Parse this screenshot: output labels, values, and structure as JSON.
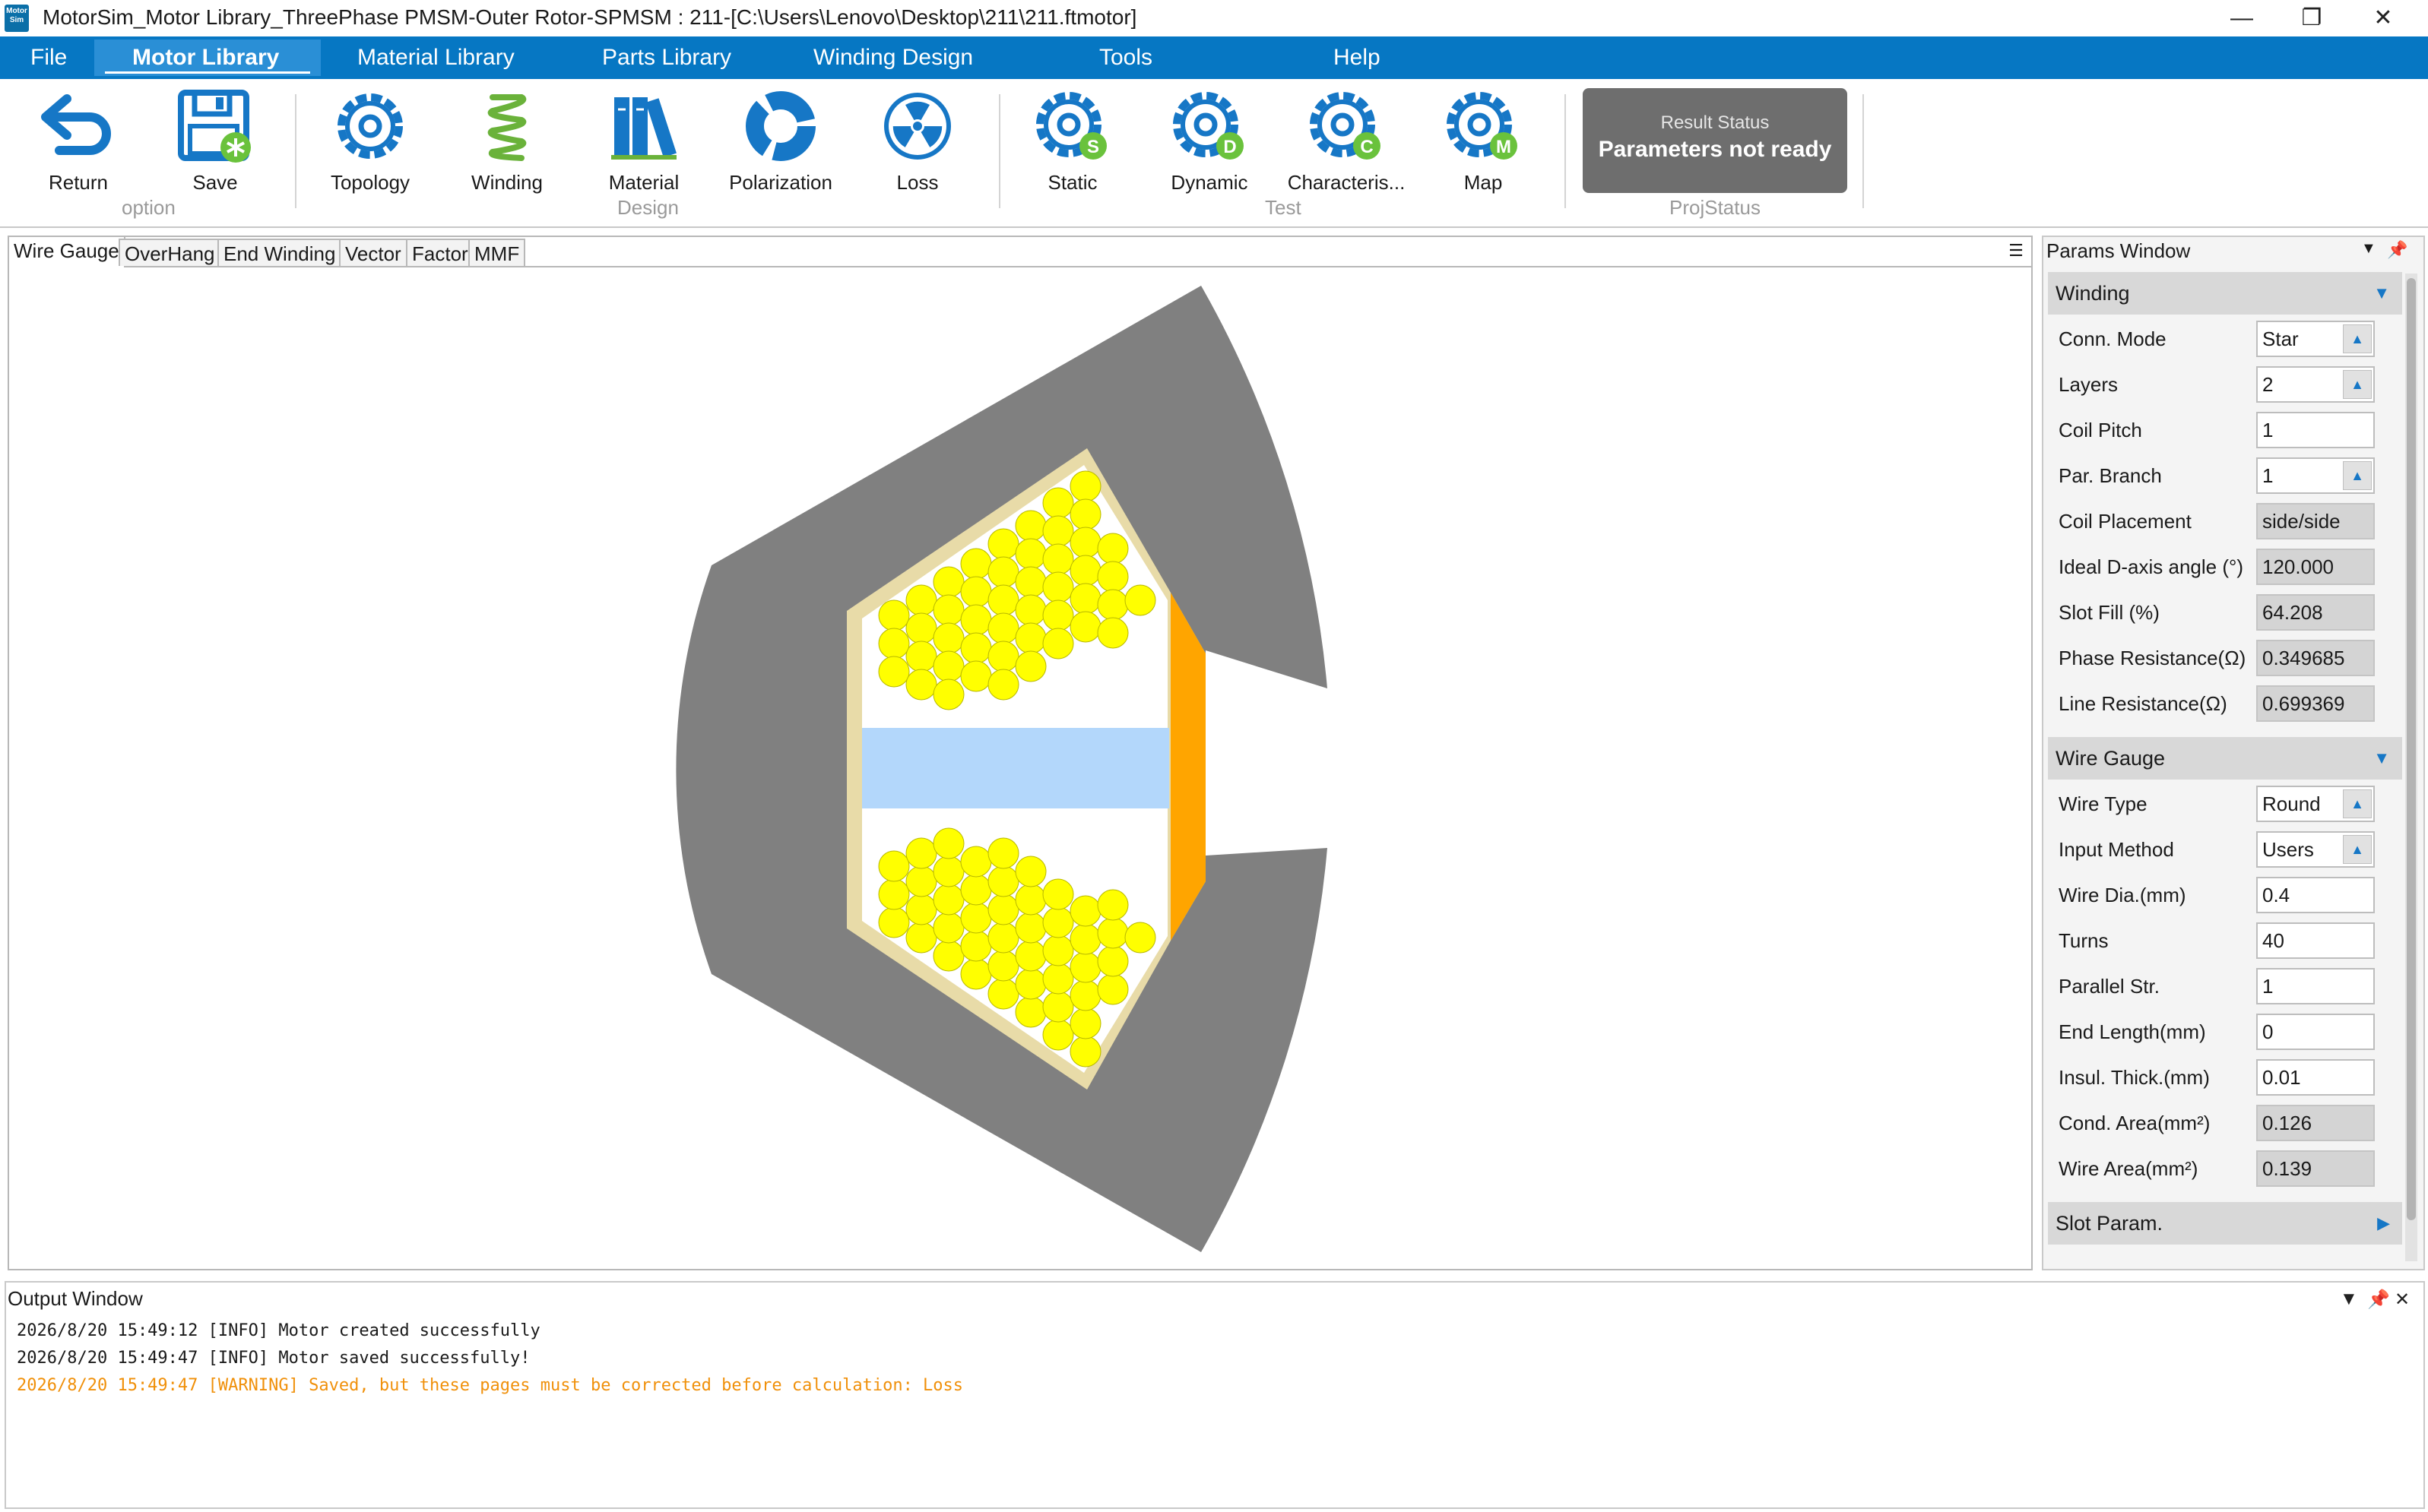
{
  "window": {
    "logo_text": "Motor Sim",
    "title": "MotorSim_Motor Library_ThreePhase PMSM-Outer Rotor-SPMSM : 211-[C:\\Users\\Lenovo\\Desktop\\211\\211.ftmotor]",
    "controls": {
      "minimize": "—",
      "restore": "❐",
      "close": "✕"
    }
  },
  "menu": {
    "items": [
      "File",
      "Motor Library",
      "Material Library",
      "Parts Library",
      "Winding Design",
      "Tools",
      "Help"
    ],
    "active": "Motor Library"
  },
  "ribbon": {
    "buttons": [
      {
        "label": "Return",
        "icon": "return-arrow-icon"
      },
      {
        "label": "Save",
        "icon": "save-disk-icon"
      },
      {
        "label": "Topology",
        "icon": "topology-gear-icon"
      },
      {
        "label": "Winding",
        "icon": "winding-coil-icon"
      },
      {
        "label": "Material",
        "icon": "material-books-icon"
      },
      {
        "label": "Polarization",
        "icon": "polarization-ring-icon"
      },
      {
        "label": "Loss",
        "icon": "loss-radiation-icon"
      },
      {
        "label": "Static",
        "icon": "static-gear-icon",
        "badge": "S"
      },
      {
        "label": "Dynamic",
        "icon": "dynamic-gear-icon",
        "badge": "D"
      },
      {
        "label": "Characteris...",
        "icon": "characteristic-gear-icon",
        "badge": "C"
      },
      {
        "label": "Map",
        "icon": "map-gear-icon",
        "badge": "M"
      }
    ],
    "groups": [
      "option",
      "Design",
      "Test",
      "ProjStatus"
    ],
    "status": {
      "title": "Result Status",
      "value": "Parameters not ready"
    }
  },
  "tabs": {
    "items": [
      "Wire Gauge",
      "OverHang",
      "End Winding",
      "Vector",
      "Factor",
      "MMF"
    ],
    "active": "Wire Gauge"
  },
  "params": {
    "title": "Params Window",
    "winding": {
      "header": "Winding",
      "rows": [
        {
          "label": "Conn. Mode",
          "value": "Star",
          "kind": "combo"
        },
        {
          "label": "Layers",
          "value": "2",
          "kind": "combo"
        },
        {
          "label": "Coil Pitch",
          "value": "1",
          "kind": "input"
        },
        {
          "label": "Par. Branch",
          "value": "1",
          "kind": "combo"
        },
        {
          "label": "Coil Placement",
          "value": "side/side",
          "kind": "readonly"
        },
        {
          "label": "Ideal D-axis angle (°)",
          "value": "120.000",
          "kind": "readonly"
        },
        {
          "label": "Slot Fill (%)",
          "value": "64.208",
          "kind": "readonly"
        },
        {
          "label": "Phase Resistance(Ω)",
          "value": "0.349685",
          "kind": "readonly"
        },
        {
          "label": "Line Resistance(Ω)",
          "value": "0.699369",
          "kind": "readonly"
        }
      ]
    },
    "wire_gauge": {
      "header": "Wire Gauge",
      "rows": [
        {
          "label": "Wire Type",
          "value": "Round",
          "kind": "combo"
        },
        {
          "label": "Input Method",
          "value": "Users",
          "kind": "combo"
        },
        {
          "label": "Wire Dia.(mm)",
          "value": "0.4",
          "kind": "input"
        },
        {
          "label": "Turns",
          "value": "40",
          "kind": "input"
        },
        {
          "label": "Parallel Str.",
          "value": "1",
          "kind": "input"
        },
        {
          "label": "End Length(mm)",
          "value": "0",
          "kind": "input"
        },
        {
          "label": "Insul. Thick.(mm)",
          "value": "0.01",
          "kind": "input"
        },
        {
          "label": "Cond. Area(mm²)",
          "value": "0.126",
          "kind": "readonly"
        },
        {
          "label": "Wire Area(mm²)",
          "value": "0.139",
          "kind": "readonly"
        }
      ]
    },
    "slot_param": {
      "header": "Slot Param."
    }
  },
  "output": {
    "title": "Output Window",
    "lines": [
      {
        "text": "2026/8/20 15:49:12 [INFO] Motor created successfully",
        "level": "info"
      },
      {
        "text": "2026/8/20 15:49:47 [INFO] Motor saved successfully!",
        "level": "info"
      },
      {
        "text": "2026/8/20 15:49:47 [WARNING] Saved, but these pages must be corrected before calculation: Loss",
        "level": "warning"
      }
    ]
  },
  "colors": {
    "menu_bg": "#0677c3",
    "accent": "#1677c6",
    "status_box": "#6e6e6e",
    "core_gray": "#808080",
    "slot_liner": "#e8dba8",
    "conductor": "#ffff00",
    "separator": "#b3d7fb",
    "wedge": "#ffa500",
    "warning_text": "#f0900a",
    "badge_green": "#6ac23c"
  }
}
